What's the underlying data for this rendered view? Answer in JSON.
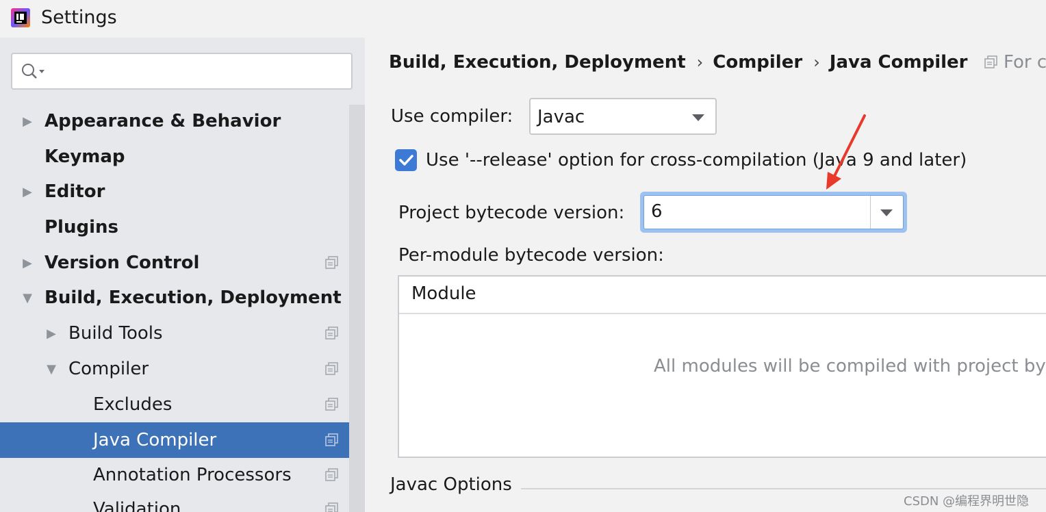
{
  "window": {
    "title": "Settings"
  },
  "search": {
    "placeholder": "",
    "value": ""
  },
  "sidebar": {
    "items": [
      {
        "label": "Appearance & Behavior",
        "bold": true,
        "arrow": "collapsed"
      },
      {
        "label": "Keymap",
        "bold": true,
        "arrow": "none"
      },
      {
        "label": "Editor",
        "bold": true,
        "arrow": "collapsed"
      },
      {
        "label": "Plugins",
        "bold": true,
        "arrow": "none"
      },
      {
        "label": "Version Control",
        "bold": true,
        "arrow": "collapsed"
      },
      {
        "label": "Build, Execution, Deployment",
        "bold": true,
        "arrow": "expanded"
      },
      {
        "label": "Build Tools",
        "bold": false,
        "arrow": "collapsed"
      },
      {
        "label": "Compiler",
        "bold": false,
        "arrow": "expanded"
      },
      {
        "label": "Excludes",
        "bold": false,
        "arrow": "none"
      },
      {
        "label": "Java Compiler",
        "bold": false,
        "arrow": "none",
        "selected": true
      },
      {
        "label": "Annotation Processors",
        "bold": false,
        "arrow": "none"
      },
      {
        "label": "Validation",
        "bold": false,
        "arrow": "none"
      }
    ]
  },
  "breadcrumb": {
    "items": [
      "Build, Execution, Deployment",
      "Compiler",
      "Java Compiler"
    ],
    "separator": "›",
    "for_project": "For c"
  },
  "form": {
    "use_compiler_label": "Use compiler:",
    "use_compiler_value": "Javac",
    "release_option_label": "Use '--release' option for cross-compilation (Java 9 and later)",
    "release_option_checked": true,
    "project_bytecode_label": "Project bytecode version:",
    "project_bytecode_value": "6",
    "per_module_label": "Per-module bytecode version:",
    "module_column": "Module",
    "module_empty_text": "All modules will be compiled with project by",
    "javac_options_label": "Javac Options"
  },
  "watermark": "CSDN @编程界明世隐",
  "colors": {
    "accent": "#3d72b8",
    "checkbox": "#3d7ad6",
    "annotation_arrow": "#e8392b"
  },
  "icons": {
    "app": "intellij-idea-icon",
    "search": "search-icon",
    "copy": "project-settings-icon",
    "checkbox": "checkmark-icon",
    "arrow": "dropdown-arrow-icon"
  }
}
